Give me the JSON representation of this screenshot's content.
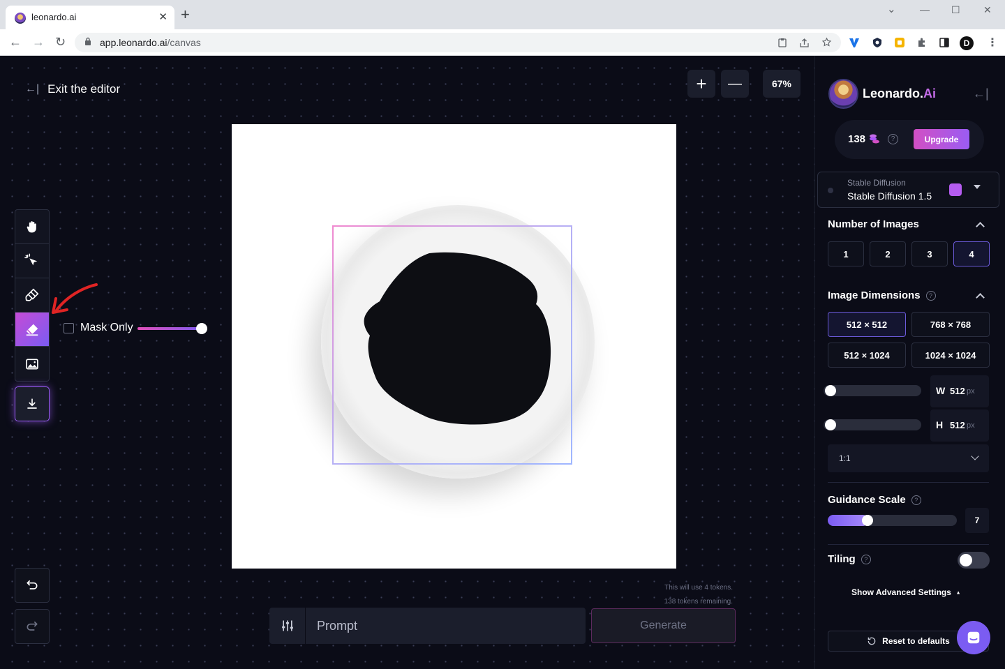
{
  "browser": {
    "tab_title": "leonardo.ai",
    "close_glyph": "✕",
    "newtab_glyph": "+",
    "url_host": "app.leonardo.ai",
    "url_path": "/canvas",
    "window_controls": {
      "minimize": "—",
      "maximize": "☐",
      "close": "✕",
      "tabsearch": "⌄"
    },
    "profile_initial": "D",
    "nav": {
      "back": "←",
      "forward": "→",
      "reload": "↻"
    },
    "menu": "⋮"
  },
  "editor": {
    "exit_label": "Exit the editor",
    "exit_icon": "←|",
    "zoom_in": "+",
    "zoom_out": "—",
    "zoom_level": "67%",
    "mask_only_label": "Mask Only",
    "mask_only_checked": false,
    "brush_size_fraction": 1.0,
    "tools": [
      "hand-icon",
      "select-icon",
      "brush-icon",
      "eraser-icon",
      "image-icon"
    ],
    "active_tool": "eraser-icon",
    "token_notice_1": "This will use 4 tokens.",
    "token_notice_2": "138 tokens remaining.",
    "prompt_placeholder": "Prompt",
    "generate_label": "Generate"
  },
  "sidebar": {
    "brand_main": "Leonardo.",
    "brand_accent": "Ai",
    "tokens": "138",
    "help_glyph": "?",
    "upgrade_label": "Upgrade",
    "model_family": "Stable Diffusion",
    "model_name": "Stable Diffusion 1.5",
    "num_images_title": "Number of Images",
    "num_images_options": [
      "1",
      "2",
      "3",
      "4"
    ],
    "num_images_selected": "4",
    "dimensions_title": "Image Dimensions",
    "dimension_options": [
      "512 × 512",
      "768 × 768",
      "512 × 1024",
      "1024 × 1024"
    ],
    "dimension_selected": "512 × 512",
    "width_label": "W",
    "width_value": "512",
    "height_label": "H",
    "height_value": "512",
    "unit": "px",
    "aspect_ratio": "1:1",
    "guidance_title": "Guidance Scale",
    "guidance_value": "7",
    "tiling_title": "Tiling",
    "tiling_on": false,
    "advanced_label": "Show Advanced Settings",
    "advanced_caret": "▲",
    "reset_label": "Reset to defaults",
    "collapse_icon": "←|"
  },
  "colors": {
    "accent_pink": "#d24fc4",
    "accent_purple": "#7b5cf2",
    "background": "#0b0c17",
    "annotation_arrow": "#e02424"
  }
}
